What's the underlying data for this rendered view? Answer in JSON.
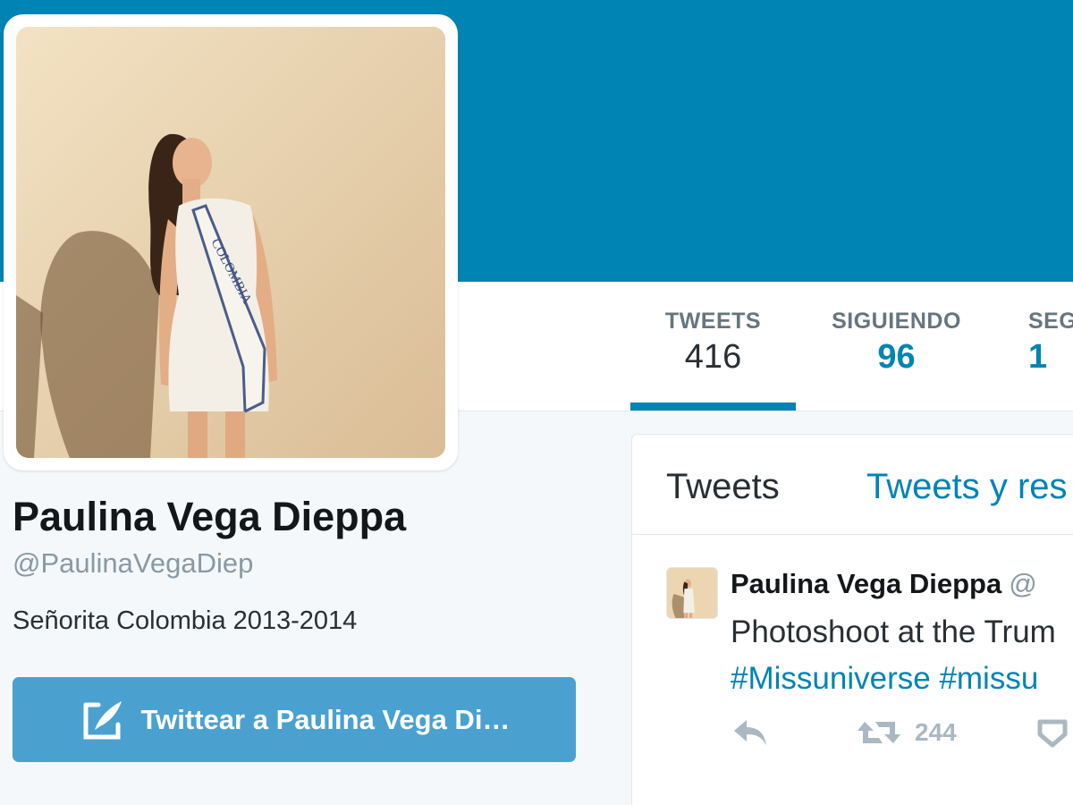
{
  "profile": {
    "name": "Paulina Vega Dieppa",
    "handle": "@PaulinaVegaDiep",
    "bio": "Señorita Colombia 2013-2014",
    "sash_text": "COLOMBIA"
  },
  "stats": [
    {
      "label": "TWEETS",
      "value": "416"
    },
    {
      "label": "SIGUIENDO",
      "value": "96"
    },
    {
      "label": "SEG",
      "value": "1"
    }
  ],
  "tweet_to_button": {
    "label": "Twittear a Paulina Vega Di…",
    "icon": "compose-icon"
  },
  "timeline": {
    "tabs": [
      {
        "label": "Tweets"
      },
      {
        "label": "Tweets y res"
      }
    ]
  },
  "tweet": {
    "author": "Paulina Vega Dieppa",
    "handle": "@",
    "text": "Photoshoot at the Trum",
    "hashtags": [
      "#Missuniverse",
      "#missu"
    ],
    "actions": [
      {
        "icon": "reply-icon"
      },
      {
        "icon": "retweet-icon",
        "count": "244"
      },
      {
        "icon": "like-icon"
      }
    ]
  },
  "colors": {
    "brand": "#0084b4",
    "button": "#4aa1d0",
    "muted": "#8899a6"
  }
}
